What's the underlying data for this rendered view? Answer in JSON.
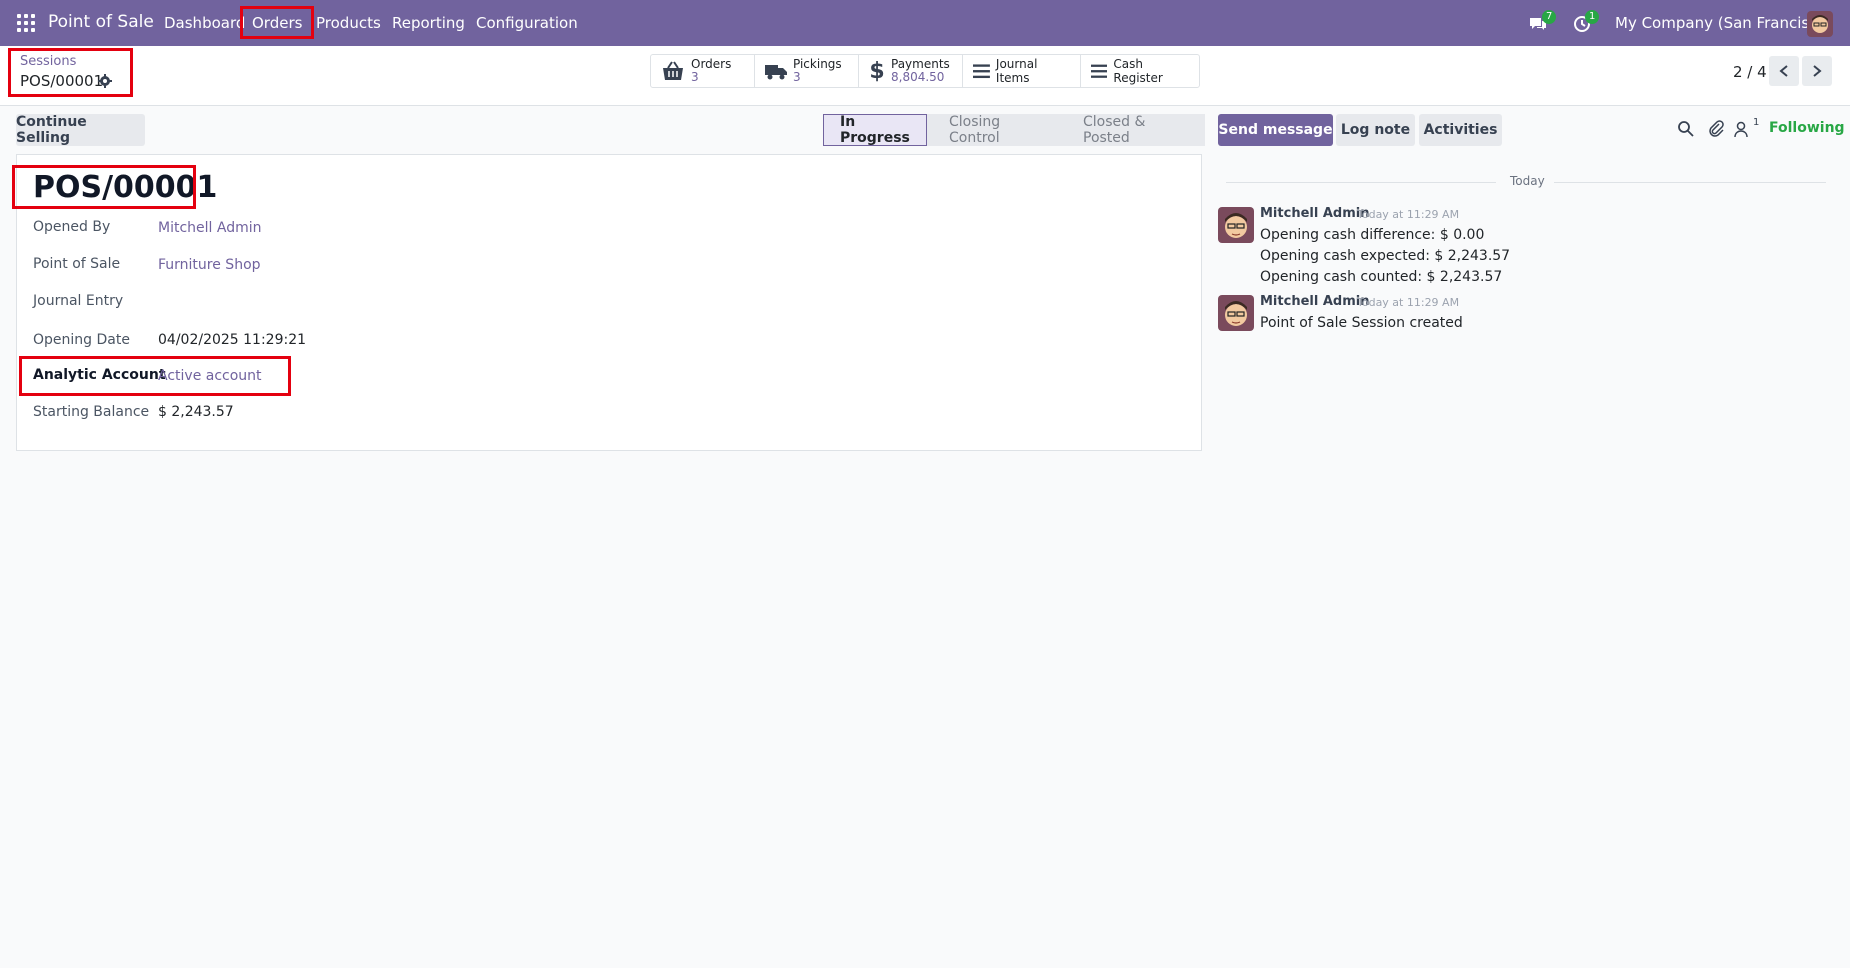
{
  "navbar": {
    "app_title": "Point of Sale",
    "menu": [
      "Dashboard",
      "Orders",
      "Products",
      "Reporting",
      "Configuration"
    ],
    "messages_badge": "7",
    "activities_badge": "1",
    "company": "My Company (San Francisco)"
  },
  "breadcrumb": {
    "parent": "Sessions",
    "current": "POS/00001"
  },
  "stat_buttons": {
    "orders": {
      "label": "Orders",
      "value": "3"
    },
    "pickings": {
      "label": "Pickings",
      "value": "3"
    },
    "payments": {
      "label": "Payments",
      "value": "8,804.50"
    },
    "journal_items": {
      "label": "Journal Items"
    },
    "cash_register": {
      "label": "Cash Register"
    }
  },
  "pager": {
    "value": "2 / 4"
  },
  "actions": {
    "continue_selling": "Continue Selling"
  },
  "statusbar": {
    "steps": [
      "In Progress",
      "Closing Control",
      "Closed & Posted"
    ],
    "active": "In Progress"
  },
  "record": {
    "title": "POS/00001",
    "fields": {
      "opened_by": {
        "label": "Opened By",
        "value": "Mitchell Admin"
      },
      "point_of_sale": {
        "label": "Point of Sale",
        "value": "Furniture Shop"
      },
      "journal_entry": {
        "label": "Journal Entry",
        "value": ""
      },
      "opening_date": {
        "label": "Opening Date",
        "value": "04/02/2025 11:29:21"
      },
      "analytic_account": {
        "label": "Analytic Account",
        "value": "Active account"
      },
      "starting_balance": {
        "label": "Starting Balance",
        "value": "$ 2,243.57"
      }
    }
  },
  "chatter": {
    "send_message": "Send message",
    "log_note": "Log note",
    "activities": "Activities",
    "followers_count": "1",
    "following": "Following",
    "date_separator": "Today",
    "messages": [
      {
        "author": "Mitchell Admin",
        "time": "Today at 11:29 AM",
        "lines": [
          "Opening cash difference: $ 0.00",
          "Opening cash expected: $ 2,243.57",
          "Opening cash counted: $ 2,243.57"
        ]
      },
      {
        "author": "Mitchell Admin",
        "time": "Today at 11:29 AM",
        "lines": [
          "Point of Sale Session created"
        ]
      }
    ]
  },
  "colors": {
    "brand": "#71639e",
    "highlight": "#e4000f",
    "success": "#28a745"
  }
}
